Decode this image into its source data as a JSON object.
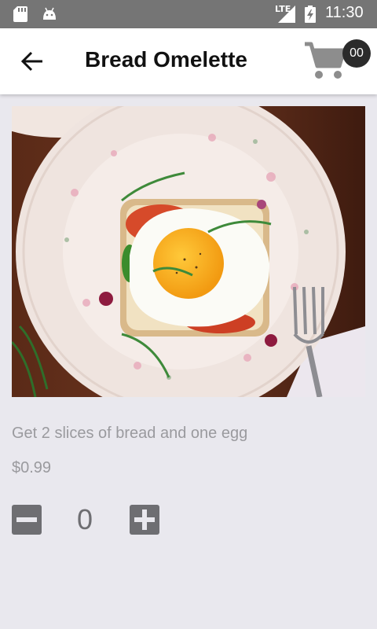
{
  "status_bar": {
    "network_label": "LTE",
    "time": "11:30",
    "icons": [
      "sd-card-icon",
      "android-icon",
      "signal-icon",
      "battery-charging-icon"
    ]
  },
  "header": {
    "title": "Bread Omelette",
    "back_icon": "arrow-left-icon",
    "cart_icon": "shopping-cart-icon",
    "cart_count": "00"
  },
  "product": {
    "image_alt": "bread-omelette-photo",
    "description": "Get 2 slices of bread and one egg",
    "price": "$0.99"
  },
  "quantity": {
    "value": "0",
    "decrement_icon": "minus-icon",
    "increment_icon": "plus-icon"
  },
  "colors": {
    "background": "#e9e8ee",
    "status_bar": "#757575",
    "app_bar": "#ffffff",
    "badge": "#2b2b2b",
    "text_muted": "#9a9a9e",
    "control": "#6e6e72"
  }
}
